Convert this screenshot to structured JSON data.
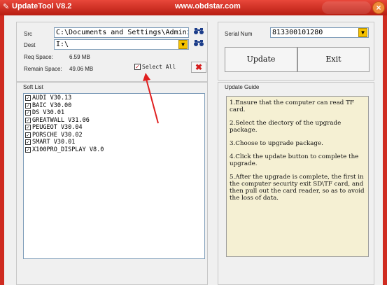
{
  "window": {
    "title": "UpdateTool  V8.2",
    "url": "www.obdstar.com",
    "close_glyph": "×"
  },
  "src": {
    "label": "Src",
    "value": "C:\\Documents and Settings\\Administ"
  },
  "dest": {
    "label": "Dest",
    "value": "I:\\"
  },
  "space": {
    "req_label": "Req Space:",
    "req_value": "6.59 MB",
    "remain_label": "Remain Space:",
    "remain_value": "49.06 MB"
  },
  "select_all": {
    "label": "Select All",
    "checked": true
  },
  "serial": {
    "label": "Serial Num",
    "value": "813300101280"
  },
  "buttons": {
    "update": "Update",
    "exit": "Exit"
  },
  "soft_list": {
    "title": "Soft List",
    "items": [
      {
        "label": "AUDI V30.13",
        "checked": true
      },
      {
        "label": "BAIC V30.00",
        "checked": true
      },
      {
        "label": "DS V30.01",
        "checked": true
      },
      {
        "label": "GREATWALL V31.06",
        "checked": true
      },
      {
        "label": "PEUGEOT V30.04",
        "checked": true
      },
      {
        "label": "PORSCHE V30.02",
        "checked": true
      },
      {
        "label": "SMART V30.01",
        "checked": true
      },
      {
        "label": "X100PRO_DISPLAY V8.0",
        "checked": true
      }
    ]
  },
  "guide": {
    "title": "Update Guide",
    "steps": [
      "1.Ensure that the computer can read TF card.",
      "2.Select the diectory of the upgrade package.",
      "3.Choose to upgrade package.",
      "4.Click the update button to complete the upgrade.",
      "5.After the upgrade is complete, the first in the computer security exit SD\\TF card, and then pull out the card reader, so as to avoid the loss of data."
    ]
  },
  "icons": {
    "browse": "binoculars-icon",
    "dropdown": "chevron-down-icon",
    "clear": "red-x-icon"
  },
  "colors": {
    "window_frame": "#cf2b20",
    "guide_background": "#f5f0d3",
    "annotation_arrow": "#e02020"
  }
}
